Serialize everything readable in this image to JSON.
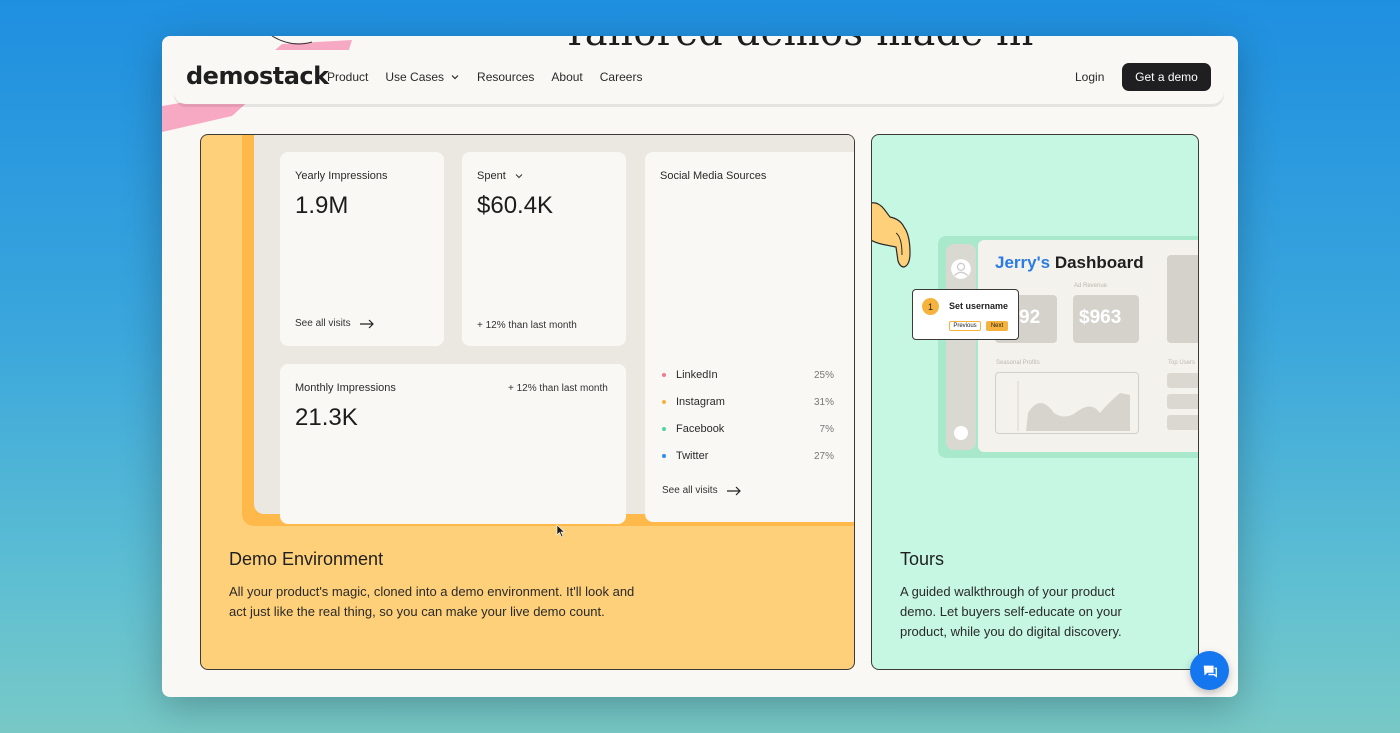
{
  "hero": {
    "partial_heading": "Tailored demos made in"
  },
  "nav": {
    "logo": "demostack",
    "links": [
      "Product",
      "Use Cases",
      "Resources",
      "About",
      "Careers"
    ],
    "login": "Login",
    "cta": "Get a demo"
  },
  "demo_card": {
    "title": "Demo Environment",
    "description_line1": "All your product's magic, cloned into a demo environment. It'll look and",
    "description_line2": "act just like the real thing, so you can make your live demo count.",
    "yearly": {
      "label": "Yearly Impressions",
      "value": "1.9M",
      "link": "See all visits"
    },
    "spent": {
      "label": "Spent",
      "value": "$60.4K",
      "note": "+ 12% than last month"
    },
    "monthly": {
      "label": "Monthly Impressions",
      "value": "21.3K",
      "note": "+ 12% than last month"
    },
    "social": {
      "label": "Social Media Sources",
      "sources": [
        {
          "name": "LinkedIn",
          "pct": "25%",
          "color": "#f07b8e"
        },
        {
          "name": "Instagram",
          "pct": "31%",
          "color": "#f5b33d"
        },
        {
          "name": "Facebook",
          "pct": "7%",
          "color": "#4fd6a0"
        },
        {
          "name": "Twitter",
          "pct": "27%",
          "color": "#2a8de8"
        }
      ],
      "link": "See all visits"
    }
  },
  "tours_card": {
    "title": "Tours",
    "description_line1": "A guided walkthrough of your product",
    "description_line2": "demo. Let buyers self-educate on your",
    "description_line3": "product, while you do digital discovery.",
    "mock": {
      "title_first": "Jerry's",
      "title_rest": "Dashboard",
      "stat1": "92",
      "stat2": "$963",
      "stat2_label": "Ad Revenue",
      "chart_label": "Seasonal Profits",
      "list_label": "Top Users"
    },
    "tooltip": {
      "step": "1",
      "label": "Set username",
      "prev": "Previous",
      "next": "Next"
    }
  },
  "colors": {
    "demo_card": "#ffd07a",
    "tours_card": "#c5f7e3",
    "cta": "#1f1f22",
    "chat": "#1477f0",
    "accent_blue": "#2a7be4"
  }
}
